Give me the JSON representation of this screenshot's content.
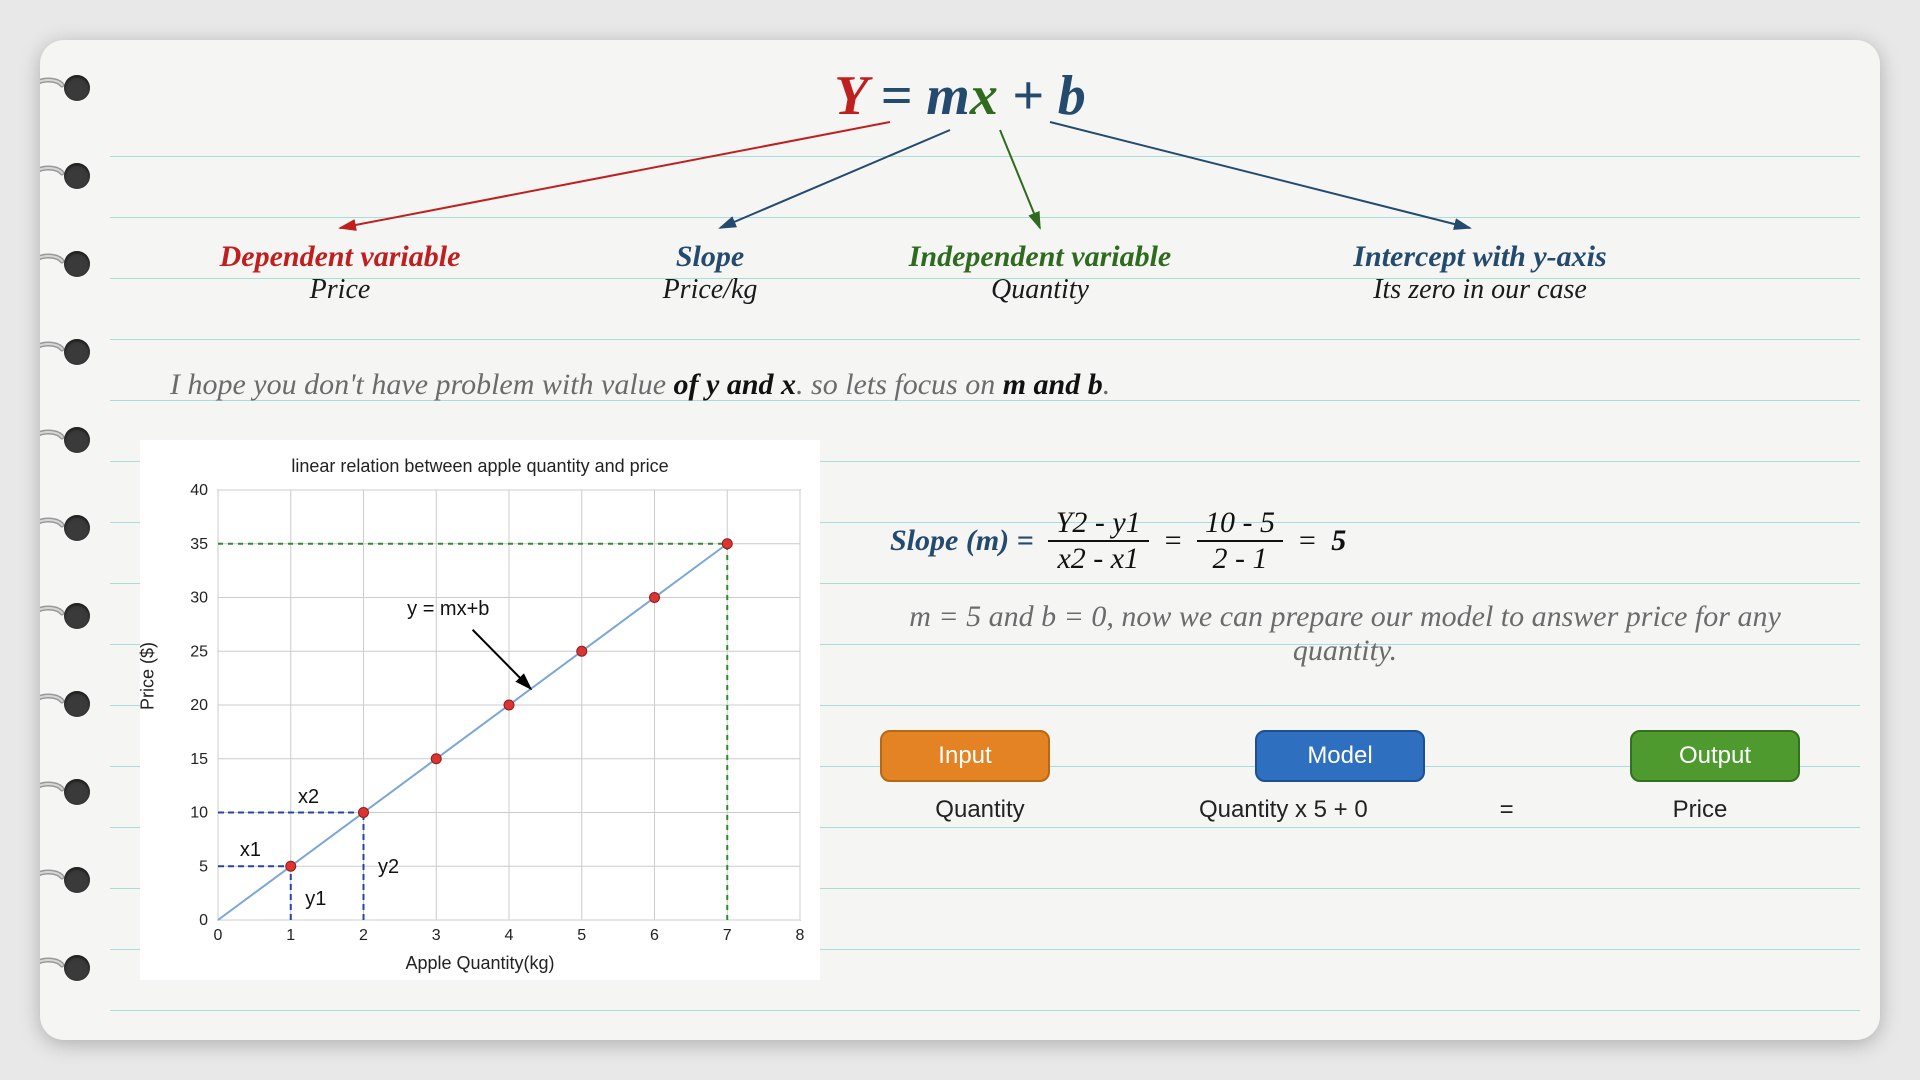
{
  "equation": {
    "y": "Y",
    "eq1": " = ",
    "m": "m",
    "x": "x",
    "plus": " + ",
    "b": "b"
  },
  "labels": {
    "dep": {
      "title": "Dependent variable",
      "sub": "Price",
      "color": "#c01f1f"
    },
    "slope": {
      "title": "Slope",
      "sub": "Price/kg",
      "color": "#244b6e"
    },
    "ind": {
      "title": "Independent variable",
      "sub": "Quantity",
      "color": "#2e6b1f"
    },
    "intc": {
      "title": "Intercept with y-axis",
      "sub": "Its zero in our case",
      "color": "#244b6e"
    }
  },
  "note": {
    "p1": "I hope you don't have problem with value ",
    "e1": "of y and x",
    "p2": ". so lets focus on ",
    "e2": "m and b",
    "p3": "."
  },
  "slope_calc": {
    "lead": "Slope (m) =",
    "num1": "Y2 - y1",
    "den1": "x2 - x1",
    "eq": "=",
    "num2": "10 - 5",
    "den2": "2 - 1",
    "eq2": "=",
    "result": "5"
  },
  "explain": "m = 5 and b = 0, now we can prepare our model to answer price for any quantity.",
  "boxes": {
    "input": "Input",
    "model": "Model",
    "output": "Output"
  },
  "boxrow2": {
    "input": "Quantity",
    "model": "Quantity x 5 + 0",
    "eq": "=",
    "output": "Price"
  },
  "chart_data": {
    "type": "scatter",
    "title": "linear relation between apple quantity and price",
    "xlabel": "Apple Quantity(kg)",
    "ylabel": "Price ($)",
    "x": [
      1,
      2,
      3,
      4,
      5,
      6,
      7
    ],
    "y": [
      5,
      10,
      15,
      20,
      25,
      30,
      35
    ],
    "xlim": [
      0,
      8
    ],
    "ylim": [
      0,
      40
    ],
    "xticks": [
      0,
      1,
      2,
      3,
      4,
      5,
      6,
      7,
      8
    ],
    "yticks": [
      0,
      5,
      10,
      15,
      20,
      25,
      30,
      35,
      40
    ],
    "annotations": {
      "line_label": "y = mx+b",
      "x1": "x1",
      "x2": "x2",
      "y1": "y1",
      "y2": "y2"
    },
    "guides": {
      "blue": [
        {
          "from": [
            0,
            5
          ],
          "to": [
            1,
            5
          ]
        },
        {
          "from": [
            1,
            0
          ],
          "to": [
            1,
            5
          ]
        },
        {
          "from": [
            0,
            10
          ],
          "to": [
            2,
            10
          ]
        },
        {
          "from": [
            2,
            0
          ],
          "to": [
            2,
            10
          ]
        }
      ],
      "green_dashed": [
        {
          "from": [
            0,
            35
          ],
          "to": [
            7,
            35
          ]
        },
        {
          "from": [
            7,
            0
          ],
          "to": [
            7,
            35
          ]
        }
      ]
    }
  }
}
